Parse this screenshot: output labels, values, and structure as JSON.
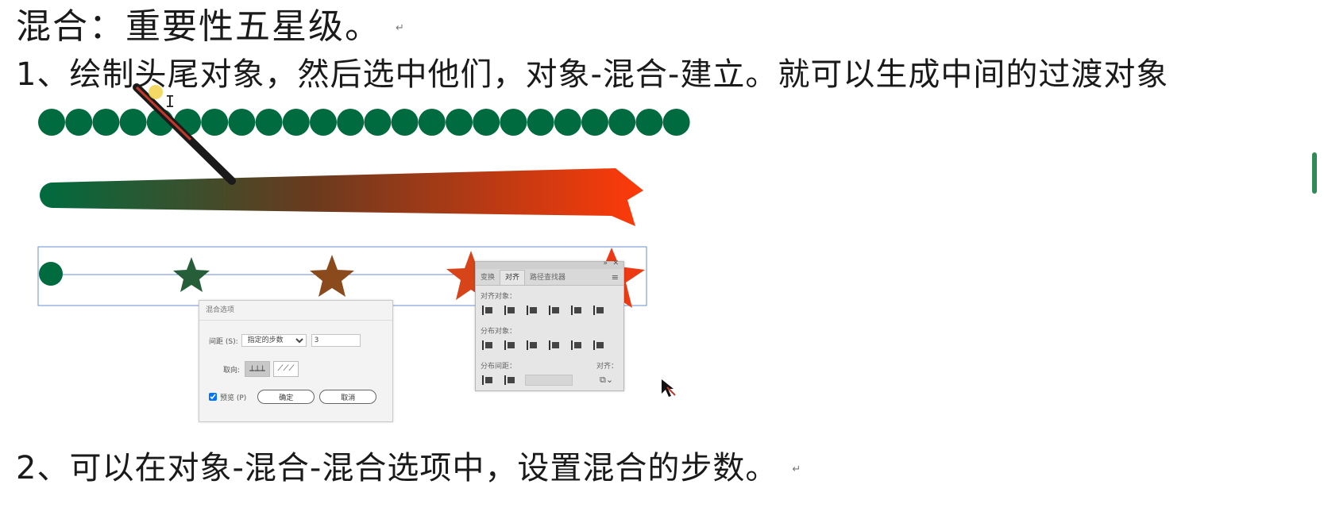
{
  "heading": "混合：重要性五星级。",
  "line1": "1、绘制头尾对象，然后选中他们，对象-混合-建立。就可以生成中间的过渡对象",
  "line2": "2、可以在对象-混合-混合选项中，设置混合的步数。",
  "return_mark": "↵",
  "colors": {
    "dark_green": "#006b3f",
    "blend_end": "#ff3a0a",
    "selection": "#6a8fd6"
  },
  "blend_dialog": {
    "title": "混合选项",
    "spacing_label": "间距 (S):",
    "spacing_value": "指定的步数",
    "steps_value": "3",
    "orientation_label": "取向:",
    "preview_label": "预览 (P)",
    "preview_checked": true,
    "ok_label": "确定",
    "cancel_label": "取消"
  },
  "align_panel": {
    "tabs": [
      "变换",
      "对齐",
      "路径查找器"
    ],
    "active_tab": "对齐",
    "align_objects_label": "对齐对象：",
    "distribute_objects_label": "分布对象：",
    "distribute_spacing_label": "分布间距：",
    "align_to_label": "对齐："
  },
  "icons": [
    "text-cursor-icon",
    "mouse-pointer-icon",
    "menu-icon",
    "close-icon",
    "collapse-icon"
  ]
}
